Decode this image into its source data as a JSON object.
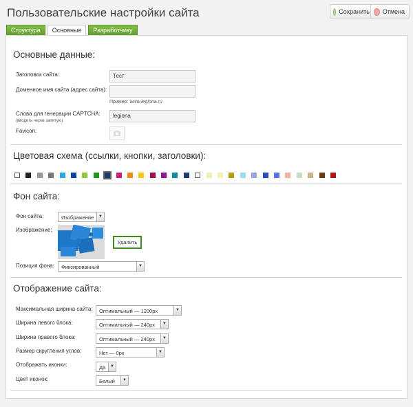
{
  "header": {
    "title": "Пользовательские настройки сайта",
    "save_label": "Сохранить",
    "cancel_label": "Отмена"
  },
  "tabs": [
    {
      "label": "Структура"
    },
    {
      "label": "Основные"
    },
    {
      "label": "Разработчику"
    }
  ],
  "basic": {
    "heading": "Основные данные:",
    "site_title_label": "Заголовок сайта:",
    "site_title_value": "Тест",
    "domain_label": "Доменное имя сайта (адрес сайта):",
    "domain_value": "",
    "domain_hint_prefix": "Пример:",
    "domain_hint_example": "www.legiona.ru",
    "captcha_label": "Слова для генерации CAPTCHA:",
    "captcha_note": "(вводить через запятую)",
    "captcha_value": "legiona",
    "favicon_label": "Favicon:"
  },
  "color_scheme": {
    "heading": "Цветовая схема (ссылки, кнопки, заголовки):",
    "colors": [
      "#ffffff",
      "#222222",
      "#999999",
      "#7a7a7a",
      "#27a9e1",
      "#0a4aa1",
      "#8dc63f",
      "#1a9b1a",
      "#1e3a6e",
      "#d11a7c",
      "#f18c1a",
      "#f5c71a",
      "#a0144b",
      "#8a1a9b",
      "#0d8aa6",
      "#1f3e70",
      "#ffffff",
      "#f5ecb8",
      "#f3f3b8",
      "#b3a11c",
      "#99e0e6",
      "#99a2e6",
      "#2a4dbd",
      "#5a73e6",
      "#f2b1a3",
      "#c8e0c2",
      "#c8b48c",
      "#6b3b12",
      "#b41515"
    ],
    "selected_index": 8
  },
  "background": {
    "heading": "Фон сайта:",
    "bg_label": "Фон сайта:",
    "bg_value": "Изображение",
    "image_label": "Изображение:",
    "delete_label": "Удалить",
    "position_label": "Позиция фона:",
    "position_value": "Фиксированный"
  },
  "display": {
    "heading": "Отображение сайта:",
    "max_width_label": "Максимальная ширина сайта:",
    "max_width_value": "Оптимальный — 1200px",
    "left_width_label": "Ширина левого блока:",
    "left_width_value": "Оптимальный — 240px",
    "right_width_label": "Ширина правого блока:",
    "right_width_value": "Оптимальный — 240px",
    "radius_label": "Размер скругления углов:",
    "radius_value": "Нет — 0px",
    "icons_label": "Отображать иконки:",
    "icons_value": "Да",
    "icon_color_label": "Цвет иконок:",
    "icon_color_value": "Белый"
  }
}
